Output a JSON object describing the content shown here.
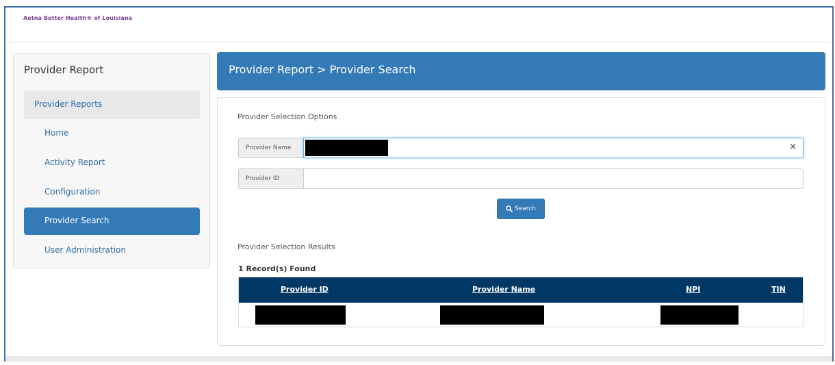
{
  "brand": "Aetna Better Health® of Louisiana",
  "sidebar": {
    "title": "Provider Report",
    "section": "Provider Reports",
    "items": [
      {
        "label": "Home",
        "active": false
      },
      {
        "label": "Activity Report",
        "active": false
      },
      {
        "label": "Configuration",
        "active": false
      },
      {
        "label": "Provider Search",
        "active": true
      },
      {
        "label": "User Administration",
        "active": false
      }
    ]
  },
  "main": {
    "breadcrumb": "Provider Report > Provider Search",
    "options_title": "Provider Selection Options",
    "fields": {
      "provider_name_label": "Provider Name",
      "provider_id_label": "Provider ID",
      "clear_symbol": "×"
    },
    "search_label": "Search",
    "results_title": "Provider Selection Results",
    "records_found": "1 Record(s) Found",
    "table": {
      "columns": [
        "Provider ID",
        "Provider Name",
        "NPI",
        "TIN"
      ]
    }
  },
  "colors": {
    "accent": "#337ab7",
    "table_header": "#003865",
    "brand": "#7d3f98"
  },
  "icons": [
    "search-icon",
    "close-icon"
  ]
}
